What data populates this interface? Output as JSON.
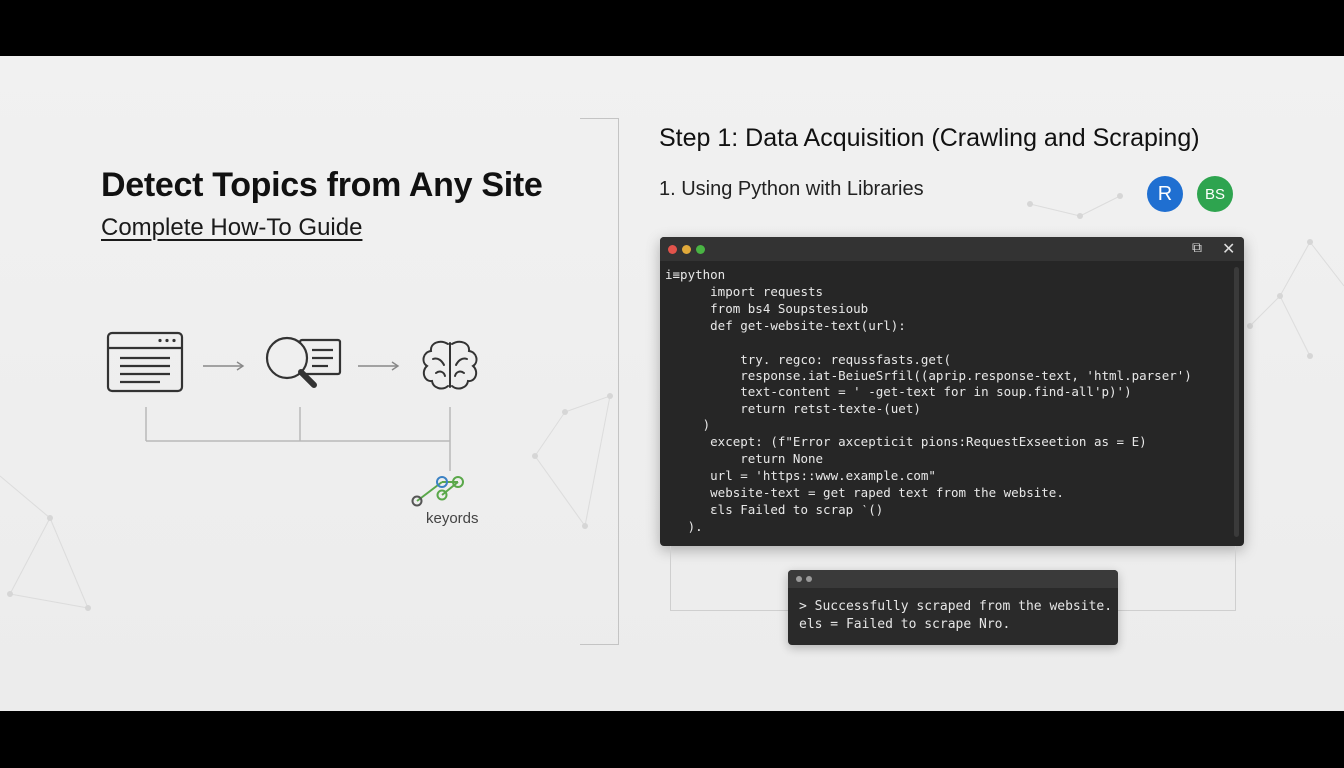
{
  "slide": {
    "title": "Detect Topics from Any Site",
    "subtitle": "Complete How-To Guide",
    "keywords_label": "keyords"
  },
  "step": {
    "title": "Step 1: Data Acquisition (Crawling and Scraping)",
    "subtitle": "1. Using Python with Libraries"
  },
  "badges": {
    "r": "R",
    "bs": "BS",
    "r_color": "#1f6fd1",
    "bs_color": "#2ea44f"
  },
  "code_window": {
    "lines": [
      "i≡python",
      "      import requests",
      "      from bs4 Soupstesioub",
      "      def get-website-text(url):",
      "",
      "          try. regco: requssfasts.get(",
      "          response.iat-BeiueSrfil((aprip.response-text, 'html.parser')",
      "          text-content = ' -get-text for in soup.find-all'p)')",
      "          return retst-texte-(uet)",
      "     )",
      "      except: (f\"Error axcepticit pions:RequestExseetion as = E)",
      "          return None",
      "      url = 'https::www.example.com\"",
      "      website-text = get raped text from the website.",
      "      ɛls Failed to scrap ‵()",
      "   )."
    ]
  },
  "terminal": {
    "lines": [
      "> Successfully scraped from the website.",
      "els = Failed to scrape Nro."
    ]
  },
  "colors": {
    "code_bg": "#262626",
    "dot_red": "#e2534b",
    "dot_yellow": "#e0a93a",
    "dot_green": "#49b443",
    "keyword_blue": "#3b82c4",
    "keyword_green": "#5aa84a"
  },
  "icons": {
    "browser": "browser-window-icon",
    "search": "magnifier-document-icon",
    "brain": "brain-icon",
    "keywords": "keyword-nodes-icon"
  }
}
